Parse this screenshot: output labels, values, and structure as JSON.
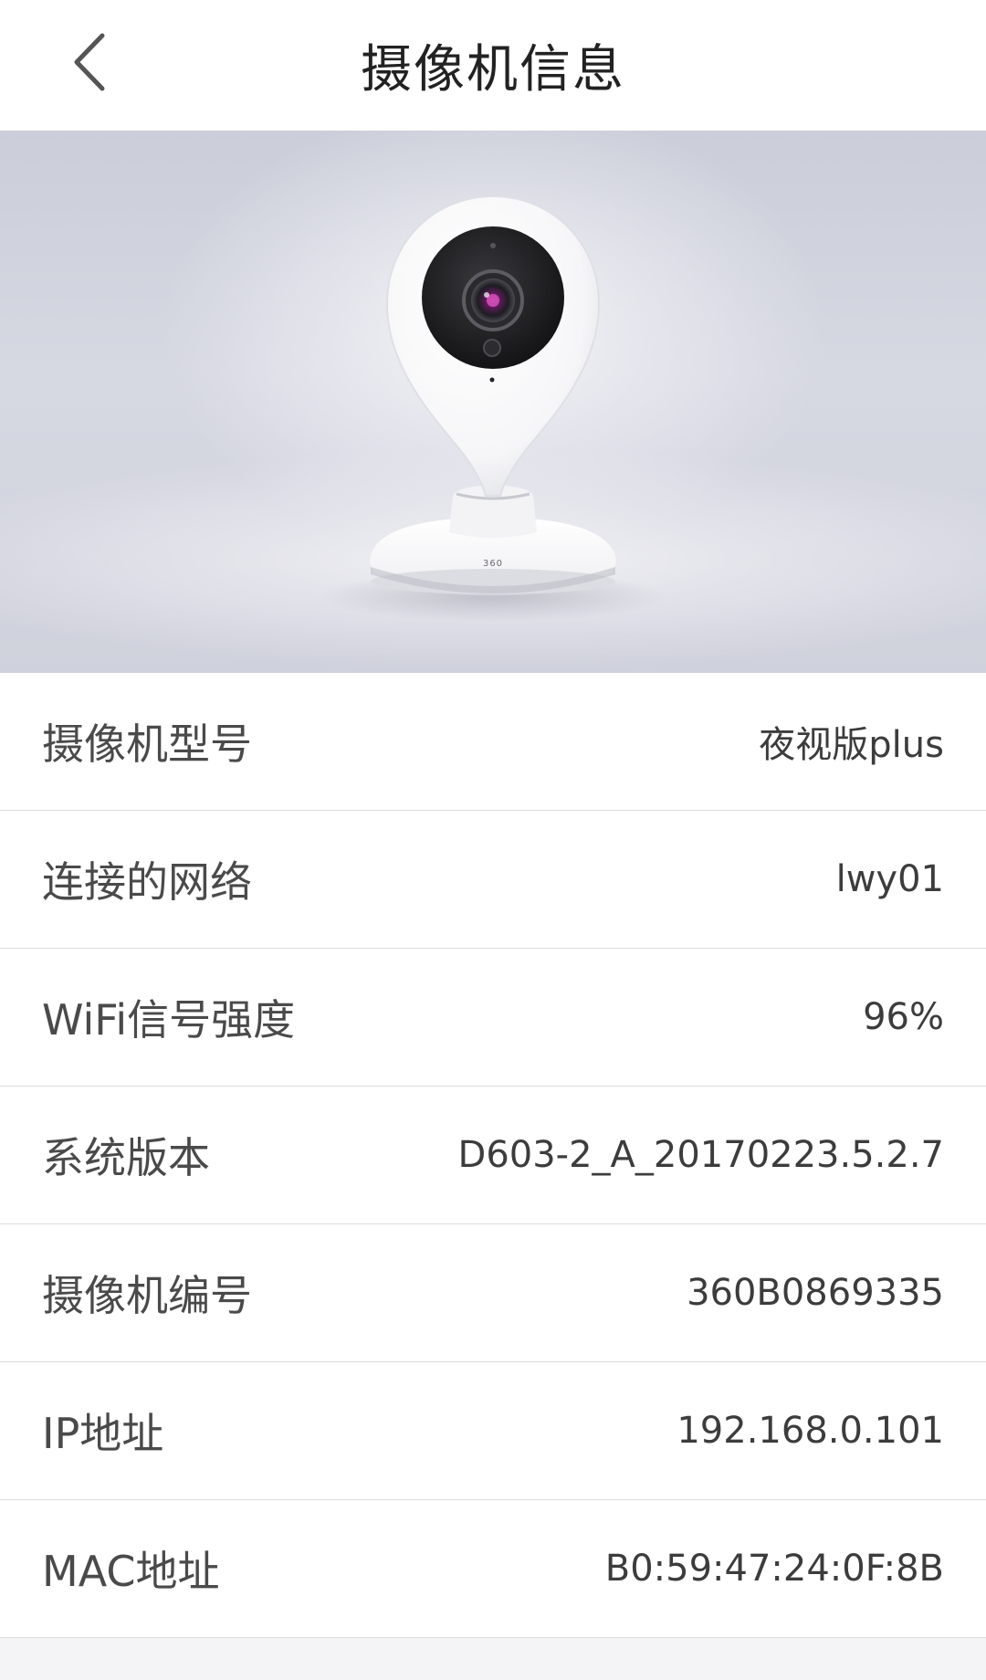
{
  "header": {
    "title": "摄像机信息",
    "back_icon": "chevron-left-icon"
  },
  "hero": {
    "brand_mark": "360"
  },
  "info": [
    {
      "label": "摄像机型号",
      "value": "夜视版plus"
    },
    {
      "label": "连接的网络",
      "value": "lwy01"
    },
    {
      "label": "WiFi信号强度",
      "value": "96%"
    },
    {
      "label": "系统版本",
      "value": "D603-2_A_20170223.5.2.7"
    },
    {
      "label": "摄像机编号",
      "value": "360B0869335"
    },
    {
      "label": "IP地址",
      "value": "192.168.0.101"
    },
    {
      "label": "MAC地址",
      "value": "B0:59:47:24:0F:8B"
    }
  ]
}
